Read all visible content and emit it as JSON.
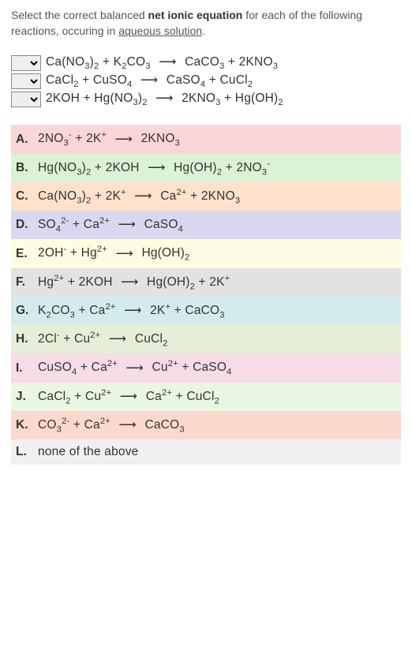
{
  "instructions": {
    "prefix": "Select the correct balanced ",
    "bold": "net ionic equation",
    "middle": " for each of the following reactions, occuring in ",
    "underlined": "aqueous solution",
    "suffix": "."
  },
  "arrow": "⟶",
  "reactions": [
    {
      "lhs": "Ca(NO₃)₂ + K₂CO₃",
      "rhs": "CaCO₃ + 2KNO₃"
    },
    {
      "lhs": "CaCl₂ + CuSO₄",
      "rhs": "CaSO₄ + CuCl₂"
    },
    {
      "lhs": "2KOH + Hg(NO₃)₂",
      "rhs": "2KNO₃ + Hg(OH)₂"
    }
  ],
  "options": [
    {
      "label": "A.",
      "lhs": "2NO₃⁻ + 2K⁺",
      "rhs": "2KNO₃",
      "cls": "c-pink"
    },
    {
      "label": "B.",
      "lhs": "Hg(NO₃)₂ + 2KOH",
      "rhs": "Hg(OH)₂ + 2NO₃⁻",
      "cls": "c-green"
    },
    {
      "label": "C.",
      "lhs": "Ca(NO₃)₂ + 2K⁺",
      "rhs": "Ca²⁺ + 2KNO₃",
      "cls": "c-orange"
    },
    {
      "label": "D.",
      "lhs": "SO₄²⁻ + Ca²⁺",
      "rhs": "CaSO₄",
      "cls": "c-purple"
    },
    {
      "label": "E.",
      "lhs": "2OH⁻ + Hg²⁺",
      "rhs": "Hg(OH)₂",
      "cls": "c-yellow"
    },
    {
      "label": "F.",
      "lhs": "Hg²⁺ + 2KOH",
      "rhs": "Hg(OH)₂ + 2K⁺",
      "cls": "c-grey"
    },
    {
      "label": "G.",
      "lhs": "K₂CO₃ + Ca²⁺",
      "rhs": "2K⁺ + CaCO₃",
      "cls": "c-teal"
    },
    {
      "label": "H.",
      "lhs": "2Cl⁻ + Cu²⁺",
      "rhs": "CuCl₂",
      "cls": "c-sage"
    },
    {
      "label": "I.",
      "lhs": "CuSO₄ + Ca²⁺",
      "rhs": "Cu²⁺ + CaSO₄",
      "cls": "c-rose"
    },
    {
      "label": "J.",
      "lhs": "CaCl₂ + Cu²⁺",
      "rhs": "Ca²⁺ + CuCl₂",
      "cls": "c-ltgrn"
    },
    {
      "label": "K.",
      "lhs": "CO₃²⁻ + Ca²⁺",
      "rhs": "CaCO₃",
      "cls": "c-coral"
    },
    {
      "label": "L.",
      "lhs": "none of the above",
      "rhs": "",
      "cls": "c-plain",
      "noarrow": true
    }
  ]
}
